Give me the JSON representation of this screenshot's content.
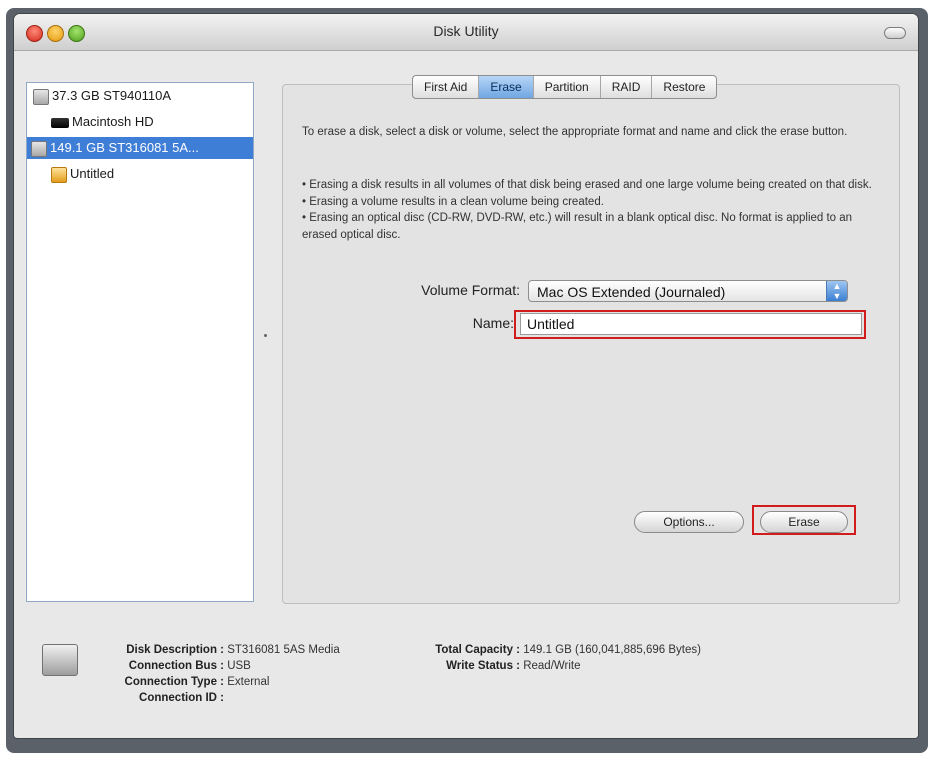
{
  "window": {
    "title": "Disk Utility"
  },
  "sidebar": {
    "items": [
      {
        "label": "37.3 GB ST940110A",
        "icon": "disk-icon"
      },
      {
        "label": "Macintosh HD",
        "icon": "hard-drive-icon"
      },
      {
        "label": "149.1 GB ST316081 5A...",
        "icon": "disk-icon",
        "selected": true
      },
      {
        "label": "Untitled",
        "icon": "volume-icon"
      }
    ]
  },
  "tabs": [
    "First Aid",
    "Erase",
    "Partition",
    "RAID",
    "Restore"
  ],
  "active_tab": "Erase",
  "erase": {
    "instructions": "To erase a disk, select a disk or volume, select the appropriate format and name and click the erase button.",
    "bullets": [
      "• Erasing a disk results in all volumes of that disk being erased and one large volume being created on that disk.",
      "• Erasing a volume results in a clean volume being created.",
      "• Erasing an optical disc (CD-RW, DVD-RW, etc.) will result in a blank optical disc. No format is applied to an erased optical disc."
    ],
    "volume_format_label": "Volume Format:",
    "volume_format_value": "Mac OS Extended (Journaled)",
    "name_label": "Name:",
    "name_value": "Untitled",
    "options_button": "Options...",
    "erase_button": "Erase"
  },
  "info": {
    "disk_description_label": "Disk Description :",
    "disk_description_value": "ST316081 5AS Media",
    "connection_bus_label": "Connection Bus :",
    "connection_bus_value": "USB",
    "connection_type_label": "Connection Type :",
    "connection_type_value": "External",
    "connection_id_label": "Connection ID :",
    "connection_id_value": "",
    "total_capacity_label": "Total Capacity :",
    "total_capacity_value": "149.1 GB (160,041,885,696 Bytes)",
    "write_status_label": "Write Status :",
    "write_status_value": "Read/Write"
  },
  "colors": {
    "highlight": "#d11c1c",
    "selection": "#3f7ed6"
  }
}
